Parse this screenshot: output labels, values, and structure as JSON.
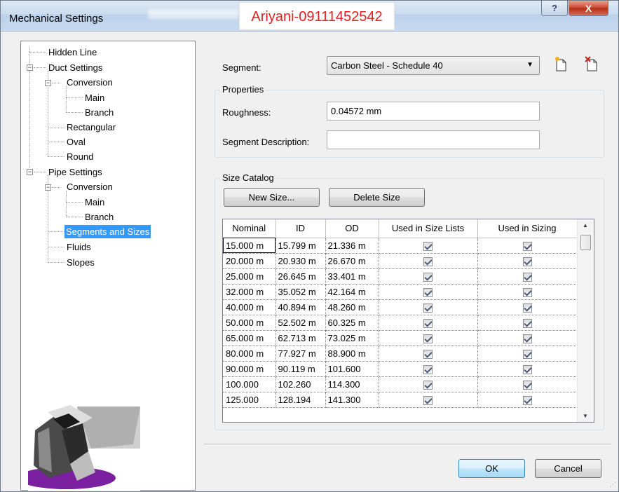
{
  "window": {
    "title": "Mechanical Settings",
    "watermark": "Ariyani-09111452542",
    "help_glyph": "?",
    "close_glyph": "X"
  },
  "tree": {
    "items": [
      {
        "label": "Hidden Line"
      },
      {
        "label": "Duct Settings"
      },
      {
        "label": "Conversion"
      },
      {
        "label": "Main"
      },
      {
        "label": "Branch"
      },
      {
        "label": "Rectangular"
      },
      {
        "label": "Oval"
      },
      {
        "label": "Round"
      },
      {
        "label": "Pipe Settings"
      },
      {
        "label": "Conversion"
      },
      {
        "label": "Main"
      },
      {
        "label": "Branch"
      },
      {
        "label": "Segments and Sizes"
      },
      {
        "label": "Fluids"
      },
      {
        "label": "Slopes"
      }
    ],
    "selected": "Segments and Sizes",
    "selection_color": "#3399ff"
  },
  "segment": {
    "label": "Segment:",
    "value": "Carbon Steel - Schedule 40",
    "new_icon": "new-segment-icon",
    "delete_icon": "delete-segment-icon"
  },
  "properties": {
    "title": "Properties",
    "roughness_label": "Roughness:",
    "roughness_value": "0.04572 mm",
    "description_label": "Segment Description:",
    "description_value": ""
  },
  "size_catalog": {
    "title": "Size Catalog",
    "new_size_label": "New Size...",
    "delete_size_label": "Delete Size",
    "columns": [
      "Nominal",
      "ID",
      "OD",
      "Used in Size Lists",
      "Used in Sizing"
    ],
    "rows": [
      {
        "nominal": "15.000 m",
        "id": "15.799 m",
        "od": "21.336 m",
        "size_lists": true,
        "sizing": true
      },
      {
        "nominal": "20.000 m",
        "id": "20.930 m",
        "od": "26.670 m",
        "size_lists": true,
        "sizing": true
      },
      {
        "nominal": "25.000 m",
        "id": "26.645 m",
        "od": "33.401 m",
        "size_lists": true,
        "sizing": true
      },
      {
        "nominal": "32.000 m",
        "id": "35.052 m",
        "od": "42.164 m",
        "size_lists": true,
        "sizing": true
      },
      {
        "nominal": "40.000 m",
        "id": "40.894 m",
        "od": "48.260 m",
        "size_lists": true,
        "sizing": true
      },
      {
        "nominal": "50.000 m",
        "id": "52.502 m",
        "od": "60.325 m",
        "size_lists": true,
        "sizing": true
      },
      {
        "nominal": "65.000 m",
        "id": "62.713 m",
        "od": "73.025 m",
        "size_lists": true,
        "sizing": true
      },
      {
        "nominal": "80.000 m",
        "id": "77.927 m",
        "od": "88.900 m",
        "size_lists": true,
        "sizing": true
      },
      {
        "nominal": "90.000 m",
        "id": "90.119 m",
        "od": "101.600",
        "size_lists": true,
        "sizing": true
      },
      {
        "nominal": "100.000",
        "id": "102.260",
        "od": "114.300",
        "size_lists": true,
        "sizing": true
      },
      {
        "nominal": "125.000",
        "id": "128.194",
        "od": "141.300",
        "size_lists": true,
        "sizing": true
      }
    ]
  },
  "footer": {
    "ok_label": "OK",
    "cancel_label": "Cancel"
  }
}
